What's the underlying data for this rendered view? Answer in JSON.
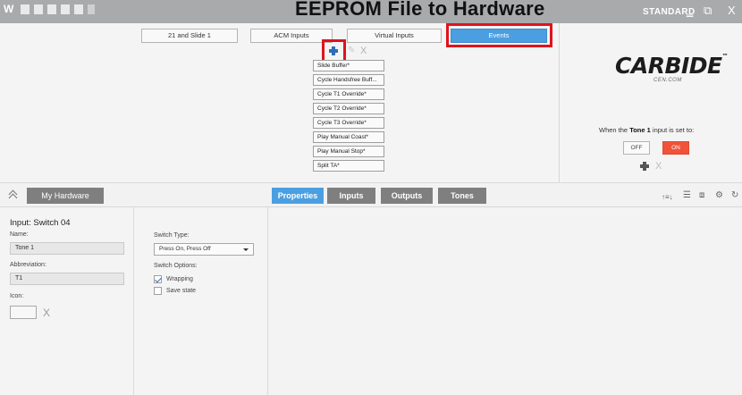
{
  "titlebar": {
    "app_logo": "W",
    "partial_title": "EEPROM File to Hardware",
    "mode_label": "STANDARD",
    "min_glyph": "‗",
    "restore_glyph": "⧉",
    "close_glyph": "X"
  },
  "tabs": [
    {
      "label": "21 and Slide 1",
      "active": false
    },
    {
      "label": "ACM Inputs",
      "active": false
    },
    {
      "label": "Virtual Inputs",
      "active": false
    },
    {
      "label": "Events",
      "active": true
    }
  ],
  "event_actions": {
    "add_icon": "plus-icon",
    "edit_icon": "pencil-icon",
    "delete_glyph": "X"
  },
  "events": [
    "Slide Buffer*",
    "Cycle Handsfree Buff...",
    "Cycle T1 Override*",
    "Cycle T2 Override*",
    "Cycle T3 Override*",
    "Play Manual Coast*",
    "Play Manual Stop*",
    "Split TA*"
  ],
  "brand": {
    "name": "CARBIDE",
    "tm": "™",
    "sub": "CEN.COM"
  },
  "tone_panel": {
    "prefix": "When the",
    "input_name": "Tone 1",
    "suffix": "input is set to:",
    "off_label": "OFF",
    "on_label": "ON",
    "on_selected": true,
    "delete_glyph": "X"
  },
  "bottom_bar": {
    "hardware_button": "My Hardware",
    "tabs": [
      {
        "label": "Properties",
        "active": true
      },
      {
        "label": "Inputs",
        "active": false
      },
      {
        "label": "Outputs",
        "active": false
      },
      {
        "label": "Tones",
        "active": false
      }
    ],
    "tools": {
      "sort": "↑≡↓",
      "list": "☰",
      "preview": "⧈",
      "settings": "⚙",
      "refresh": "↻"
    }
  },
  "input_panel": {
    "heading": "Input: Switch 04",
    "name_label": "Name:",
    "name_value": "Tone 1",
    "abbr_label": "Abbreviation:",
    "abbr_value": "T1",
    "icon_label": "Icon:",
    "icon_delete": "X"
  },
  "switch_panel": {
    "type_label": "Switch Type:",
    "type_value": "Press On, Press Off",
    "options_label": "Switch Options:",
    "options": [
      {
        "label": "Wrapping",
        "checked": true
      },
      {
        "label": "Save state",
        "checked": false
      }
    ]
  },
  "colors": {
    "accent": "#4b9fe1",
    "highlight": "#e0131c",
    "on": "#f0533a",
    "titlebar": "#a9aaac"
  }
}
